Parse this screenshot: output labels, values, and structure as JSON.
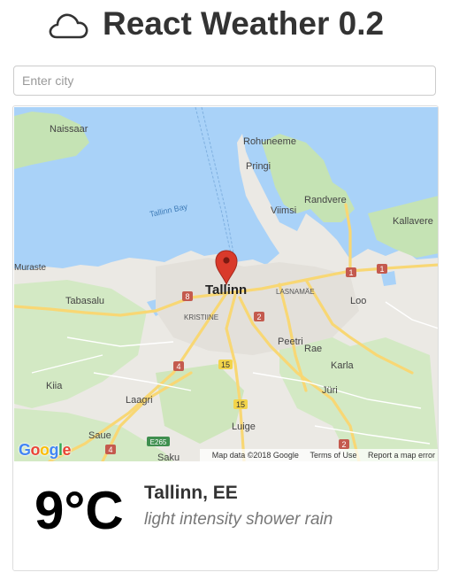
{
  "header": {
    "icon": "cloud-icon",
    "title": "React Weather 0.2"
  },
  "search": {
    "placeholder": "Enter city",
    "value": ""
  },
  "map": {
    "labels": {
      "naissaar": "Naissaar",
      "rohuneeme": "Rohuneeme",
      "pringi": "Pringi",
      "randvere": "Randvere",
      "viimsi": "Viimsi",
      "kallavere": "Kallavere",
      "tallinn_bay": "Tallinn Bay",
      "muraste": "Muraste",
      "tabasalu": "Tabasalu",
      "tallinn": "Tallinn",
      "lasnamae": "LASNAMÄE",
      "loo": "Loo",
      "kristiine": "KRISTIINE",
      "peetri": "Peetri",
      "rae": "Rae",
      "karla": "Karla",
      "kiia": "Kiia",
      "juri": "Jüri",
      "laagri": "Laagri",
      "luige": "Luige",
      "saue": "Saue",
      "saku": "Saku"
    },
    "road_shields": {
      "r1a": "1",
      "r1b": "1",
      "r8": "8",
      "r2a": "2",
      "r4a": "4",
      "r15a": "15",
      "r15b": "15",
      "e265": "E265",
      "r4b": "4",
      "r2b": "2"
    },
    "attribution": {
      "map_data": "Map data ©2018 Google",
      "terms": "Terms of Use",
      "report": "Report a map error"
    },
    "logo": "Google",
    "marker_icon": "map-pin-icon",
    "colors": {
      "water": "#a9d2f8",
      "land": "#ebe9e4",
      "green": "#c5e3b4",
      "road": "#f8d774",
      "marker": "#d93a2b"
    }
  },
  "weather": {
    "temperature": "9°C",
    "location": "Tallinn, EE",
    "description": "light intensity shower rain"
  }
}
